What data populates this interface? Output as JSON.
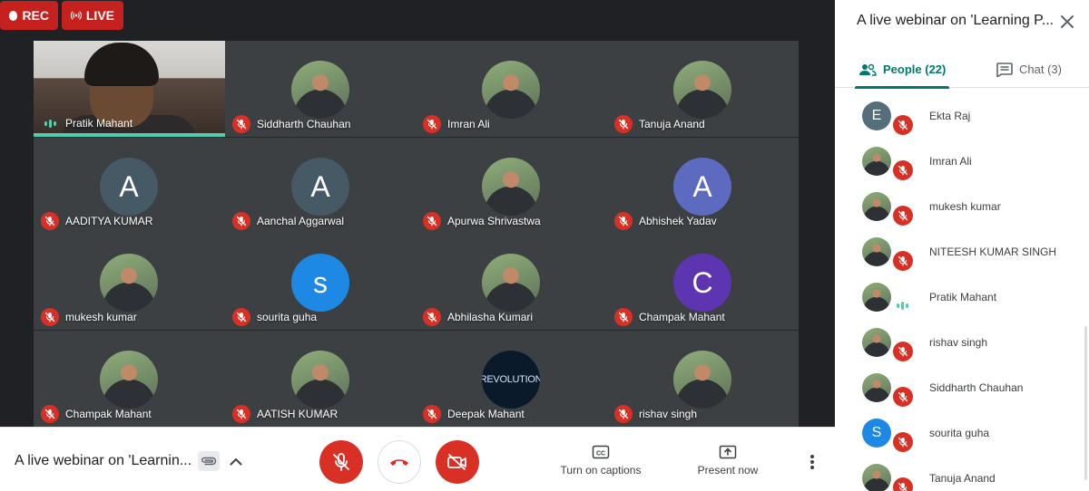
{
  "badges": {
    "rec": "REC",
    "live": "LIVE"
  },
  "colors": {
    "mute_red": "#d93025",
    "accent_teal": "#00796b",
    "speaking": "#4ecfb0"
  },
  "tiles": [
    {
      "name": "Pratik Mahant",
      "avatar_type": "video",
      "speaking": true
    },
    {
      "name": "Siddharth Chauhan",
      "avatar_type": "photo",
      "muted": true
    },
    {
      "name": "Imran Ali",
      "avatar_type": "photo",
      "muted": true
    },
    {
      "name": "Tanuja Anand",
      "avatar_type": "photo",
      "muted": true
    },
    {
      "name": "AADITYA KUMAR",
      "avatar_type": "letter",
      "initial": "A",
      "color": "#455a64",
      "muted": true
    },
    {
      "name": "Aanchal Aggarwal",
      "avatar_type": "letter",
      "initial": "A",
      "color": "#455a64",
      "muted": true
    },
    {
      "name": "Apurwa Shrivastwa",
      "avatar_type": "photo",
      "muted": true
    },
    {
      "name": "Abhishek Yadav",
      "avatar_type": "letter",
      "initial": "A",
      "color": "#5c6bc0",
      "muted": true
    },
    {
      "name": "mukesh kumar",
      "avatar_type": "photo",
      "muted": true
    },
    {
      "name": "sourita guha",
      "avatar_type": "letter",
      "initial": "s",
      "color": "#1e88e5",
      "muted": true
    },
    {
      "name": "Abhilasha Kumari",
      "avatar_type": "photo",
      "muted": true
    },
    {
      "name": "Champak Mahant",
      "avatar_type": "letter",
      "initial": "C",
      "color": "#5e35b1",
      "muted": true
    },
    {
      "name": "Champak Mahant",
      "avatar_type": "photo",
      "muted": true
    },
    {
      "name": "AATISH KUMAR",
      "avatar_type": "photo",
      "muted": true
    },
    {
      "name": "Deepak Mahant",
      "avatar_type": "photo",
      "muted": true,
      "avatar_text": "REVOLUTION"
    },
    {
      "name": "rishav singh",
      "avatar_type": "photo",
      "muted": true
    }
  ],
  "panel": {
    "title": "A live webinar on 'Learning P...",
    "tabs": {
      "people": "People (22)",
      "chat": "Chat (3)"
    },
    "people": [
      {
        "name": "Ekta Raj",
        "avatar_type": "letter",
        "initial": "E",
        "color": "#546e7a",
        "muted": true
      },
      {
        "name": "Imran Ali",
        "avatar_type": "photo",
        "muted": true
      },
      {
        "name": "mukesh kumar",
        "avatar_type": "photo",
        "muted": true
      },
      {
        "name": "NITEESH KUMAR SINGH",
        "avatar_type": "photo",
        "muted": true
      },
      {
        "name": "Pratik Mahant",
        "avatar_type": "photo",
        "speaking": true
      },
      {
        "name": "rishav singh",
        "avatar_type": "photo",
        "muted": true
      },
      {
        "name": "Siddharth Chauhan",
        "avatar_type": "photo",
        "muted": true
      },
      {
        "name": "sourita guha",
        "avatar_type": "letter",
        "initial": "S",
        "color": "#1e88e5",
        "muted": true
      },
      {
        "name": "Tanuja Anand",
        "avatar_type": "photo",
        "muted": true
      }
    ]
  },
  "bottom": {
    "meeting_title": "A live webinar on 'Learnin...",
    "captions_label": "Turn on captions",
    "captions_icon": "CC",
    "present_label": "Present now"
  }
}
